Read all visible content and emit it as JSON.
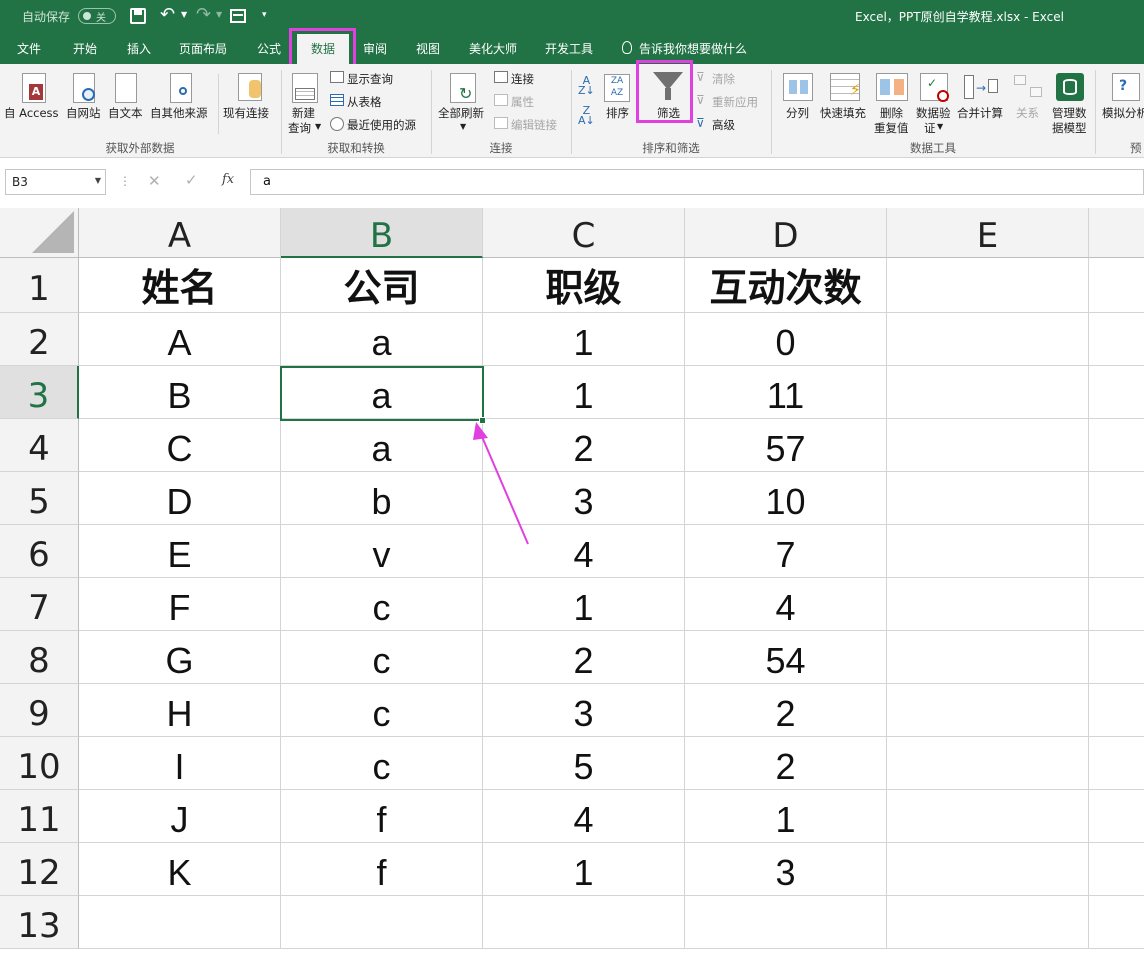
{
  "titlebar": {
    "autosave": "自动保存",
    "autosave_state": "关",
    "title": "Excel，PPT原创自学教程.xlsx  -  Excel"
  },
  "tabs": [
    "文件",
    "开始",
    "插入",
    "页面布局",
    "公式",
    "数据",
    "审阅",
    "视图",
    "美化大师",
    "开发工具"
  ],
  "tell_me": "告诉我你想要做什么",
  "ribbon": {
    "ext": {
      "access": "自 Access",
      "web": "自网站",
      "text": "自文本",
      "other": "自其他来源",
      "existing": "现有连接",
      "group": "获取外部数据"
    },
    "transform": {
      "new_query": "新建",
      "new_query2": "查询",
      "show_queries": "显示查询",
      "from_table": "从表格",
      "recent": "最近使用的源",
      "group": "获取和转换"
    },
    "conn": {
      "refresh": "全部刷新",
      "connections": "连接",
      "properties": "属性",
      "edit_links": "编辑链接",
      "group": "连接"
    },
    "sort": {
      "sort": "排序",
      "filter": "筛选",
      "clear": "清除",
      "reapply": "重新应用",
      "advanced": "高级",
      "group": "排序和筛选"
    },
    "tools": {
      "split": "分列",
      "flash": "快速填充",
      "remove_dup": "删除",
      "remove_dup2": "重复值",
      "validate": "数据验",
      "validate2": "证",
      "consolidate": "合并计算",
      "relations": "关系",
      "model": "管理数",
      "model2": "据模型",
      "group": "数据工具"
    },
    "whatif": {
      "label": "模拟分析",
      "group": "预"
    }
  },
  "formula_bar": {
    "name_box": "B3",
    "fx": "fx",
    "content": "a"
  },
  "columns": [
    "A",
    "B",
    "C",
    "D",
    "E"
  ],
  "rows": [
    "1",
    "2",
    "3",
    "4",
    "5",
    "6",
    "7",
    "8",
    "9",
    "10",
    "11",
    "12",
    "13"
  ],
  "table": [
    [
      "姓名",
      "公司",
      "职级",
      "互动次数"
    ],
    [
      "A",
      "a",
      "1",
      "0"
    ],
    [
      "B",
      "a",
      "1",
      "11"
    ],
    [
      "C",
      "a",
      "2",
      "57"
    ],
    [
      "D",
      "b",
      "3",
      "10"
    ],
    [
      "E",
      "v",
      "4",
      "7"
    ],
    [
      "F",
      "c",
      "1",
      "4"
    ],
    [
      "G",
      "c",
      "2",
      "54"
    ],
    [
      "H",
      "c",
      "3",
      "2"
    ],
    [
      "I",
      "c",
      "5",
      "2"
    ],
    [
      "J",
      "f",
      "4",
      "1"
    ],
    [
      "K",
      "f",
      "1",
      "3"
    ]
  ],
  "colors": {
    "accent": "#217346",
    "highlight": "#e040e0"
  }
}
